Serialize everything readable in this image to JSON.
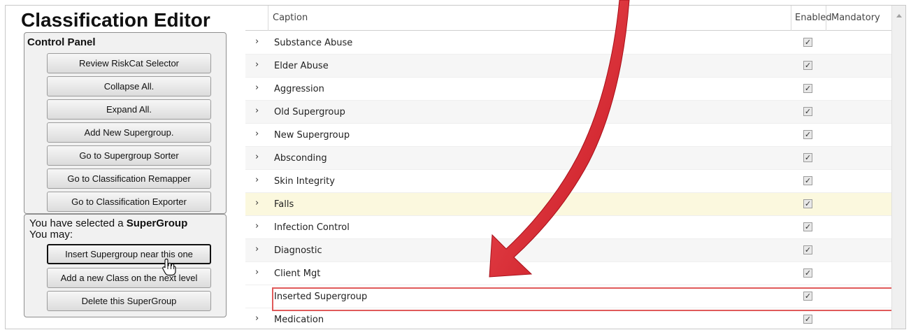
{
  "app": {
    "title": "Classification Editor"
  },
  "control_panel": {
    "title": "Control Panel",
    "buttons": [
      "Review RiskCat Selector",
      "Collapse All.",
      "Expand All.",
      "Add New Supergroup.",
      "Go to Supergroup Sorter",
      "Go to Classification Remapper",
      "Go to Classification Exporter"
    ]
  },
  "selection_panel": {
    "text_prefix": "You have selected a",
    "selected_type": "SuperGroup",
    "may_text": "You may:",
    "buttons": [
      "Insert Supergroup near this one",
      "Add a new Class on the next level",
      "Delete this SuperGroup"
    ]
  },
  "grid": {
    "columns": {
      "caption": "Caption",
      "enabled": "Enabled",
      "mandatory": "Mandatory"
    },
    "expander_glyph": "›",
    "check_glyph": "✓",
    "rows": [
      {
        "caption": "Substance Abuse",
        "enabled": true
      },
      {
        "caption": "Elder Abuse",
        "enabled": true
      },
      {
        "caption": "Aggression",
        "enabled": true
      },
      {
        "caption": "Old Supergroup",
        "enabled": true
      },
      {
        "caption": "New Supergroup",
        "enabled": true
      },
      {
        "caption": "Absconding",
        "enabled": true
      },
      {
        "caption": "Skin Integrity",
        "enabled": true
      },
      {
        "caption": "Falls",
        "enabled": true
      },
      {
        "caption": "Infection Control",
        "enabled": true
      },
      {
        "caption": "Diagnostic",
        "enabled": true
      },
      {
        "caption": "Client Mgt",
        "enabled": true
      },
      {
        "caption": "Inserted Supergroup",
        "enabled": true
      },
      {
        "caption": "Medication",
        "enabled": true
      }
    ]
  },
  "colors": {
    "arrow": "#e0212b",
    "highlight_row": "#fbf8de",
    "inserted_outline": "#e05a5a"
  }
}
